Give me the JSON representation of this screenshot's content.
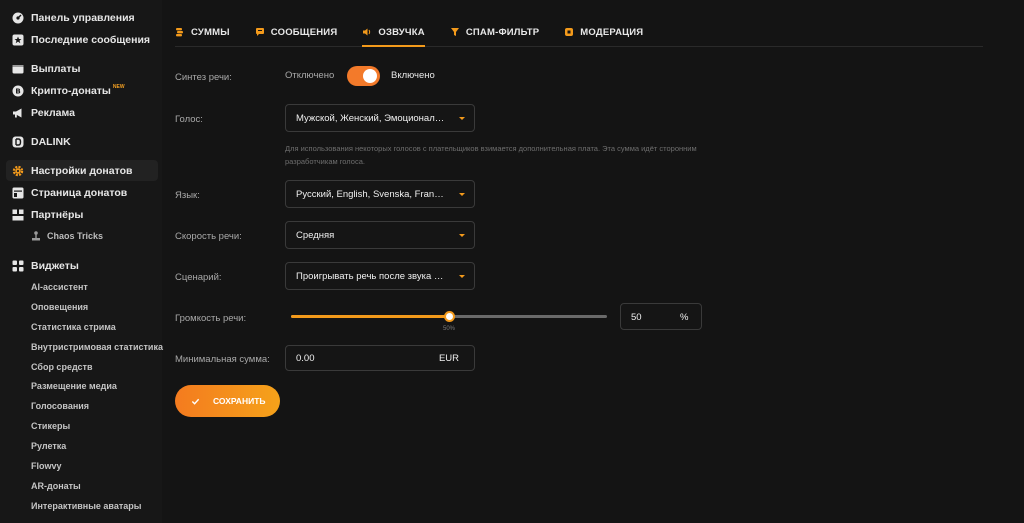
{
  "sidebar": {
    "items": [
      {
        "label": "Панель управления",
        "icon": "dashboard-icon"
      },
      {
        "label": "Последние сообщения",
        "icon": "star-icon"
      },
      {
        "label": "Выплаты",
        "icon": "wallet-icon"
      },
      {
        "label": "Крипто-донаты",
        "icon": "bitcoin-icon",
        "badge": "NEW"
      },
      {
        "label": "Реклама",
        "icon": "megaphone-icon"
      },
      {
        "label": "DALINK",
        "icon": "dalink-icon"
      },
      {
        "label": "Настройки донатов",
        "icon": "gear-icon",
        "active": true
      },
      {
        "label": "Страница донатов",
        "icon": "layout-icon"
      },
      {
        "label": "Партнёры",
        "icon": "partners-icon"
      }
    ],
    "partner_sub": "Chaos Tricks",
    "widgets_label": "Виджеты",
    "widgets": [
      "AI-ассистент",
      "Оповещения",
      "Статистика стрима",
      "Внутристримовая статистика",
      "Сбор средств",
      "Размещение медиа",
      "Голосования",
      "Стикеры",
      "Рулетка",
      "Flowvy",
      "AR-донаты",
      "Интерактивные аватары"
    ]
  },
  "tabs": [
    {
      "label": "СУММЫ",
      "icon": "coins-icon"
    },
    {
      "label": "СООБЩЕНИЯ",
      "icon": "chat-icon"
    },
    {
      "label": "ОЗВУЧКА",
      "icon": "speaker-icon",
      "active": true
    },
    {
      "label": "СПАМ-ФИЛЬТР",
      "icon": "filter-icon"
    },
    {
      "label": "МОДЕРАЦИЯ",
      "icon": "moderation-icon"
    }
  ],
  "form": {
    "tts_label": "Синтез речи:",
    "tts_off": "Отключено",
    "tts_on": "Включено",
    "tts_enabled": true,
    "voice_label": "Голос:",
    "voice_value": "Мужской, Женский, Эмоциональ...",
    "voice_hint": "Для использования некоторых голосов с плательщиков взимается дополнительная плата. Эта сумма идёт сторонним разработчикам голоса.",
    "language_label": "Язык:",
    "language_value": "Русский, English, Svenska, Franç...",
    "speed_label": "Скорость речи:",
    "speed_value": "Средняя",
    "scenario_label": "Сценарий:",
    "scenario_value": "Проигрывать речь после звука о...",
    "volume_label": "Громкость речи:",
    "volume_value": 50,
    "volume_tick": "50%",
    "volume_input": "50",
    "volume_unit": "%",
    "min_amount_label": "Минимальная сумма:",
    "min_amount_value": "0.00",
    "min_amount_currency": "EUR",
    "save_label": "СОХРАНИТЬ"
  },
  "colors": {
    "accent": "#f39a1b",
    "toggle": "#f37a2a",
    "background": "#141414"
  }
}
